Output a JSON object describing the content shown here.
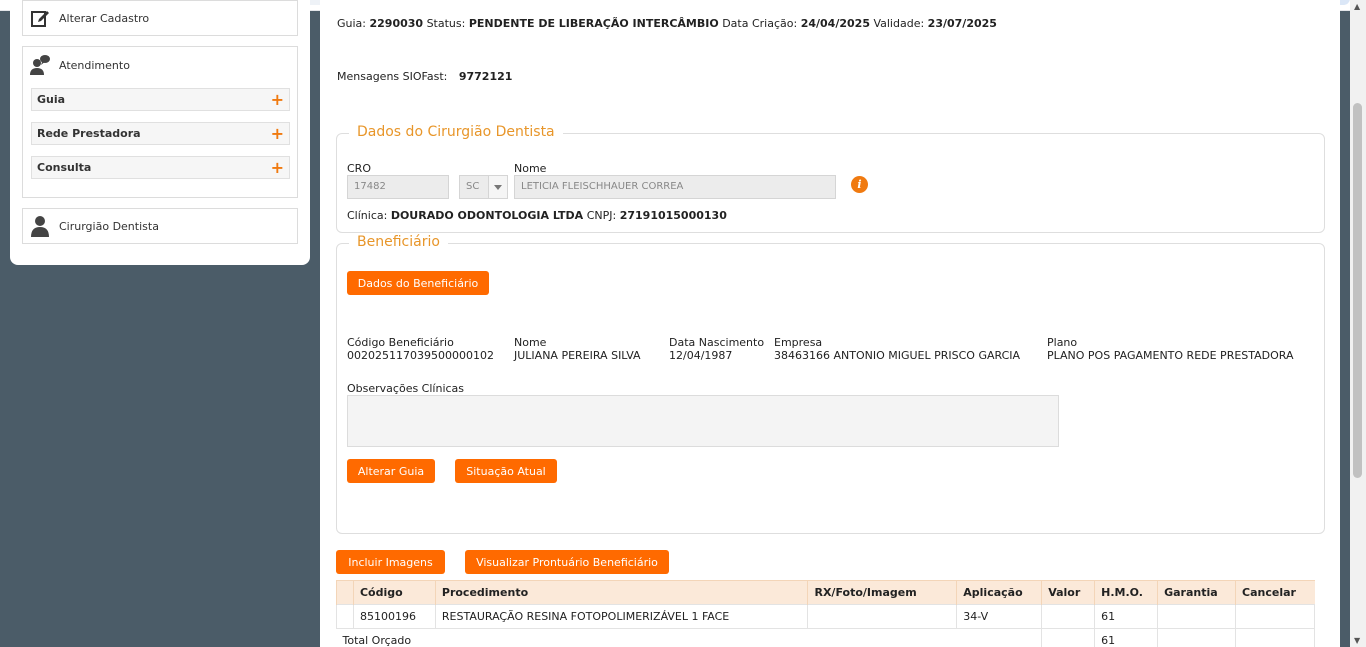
{
  "sidebar": {
    "alterar_cadastro": "Alterar Cadastro",
    "atendimento": "Atendimento",
    "subitems": [
      "Guia",
      "Rede Prestadora",
      "Consulta"
    ],
    "cirurgiao": "Cirurgião Dentista"
  },
  "header": {
    "guia_label": "Guia:",
    "guia_value": "2290030",
    "status_label": "Status:",
    "status_value": "PENDENTE DE LIBERAÇÃO INTERCÂMBIO",
    "criacao_label": "Data Criação:",
    "criacao_value": "24/04/2025",
    "validade_label": "Validade:",
    "validade_value": "23/07/2025",
    "mensagens_label": "Mensagens SIOFast:",
    "mensagens_value": "9772121"
  },
  "dentista": {
    "legend": "Dados do Cirurgião Dentista",
    "cro_label": "CRO",
    "cro_value": "17482",
    "uf_value": "SC",
    "nome_label": "Nome",
    "nome_value": "LETICIA FLEISCHHAUER CORREA",
    "clinica_label": "Clínica:",
    "clinica_value": "DOURADO ODONTOLOGIA LTDA",
    "cnpj_label": "CNPJ:",
    "cnpj_value": "27191015000130"
  },
  "beneficiario": {
    "legend": "Beneficiário",
    "dados_button": "Dados do Beneficiário",
    "codigo_label": "Código Beneficiário",
    "codigo_value": "00202511703950000010​2",
    "nome_label": "Nome",
    "nome_value": "JULIANA PEREIRA SILVA",
    "nascimento_label": "Data Nascimento",
    "nascimento_value": "12/04/1987",
    "empresa_label": "Empresa",
    "empresa_value": "38463166 ANTONIO MIGUEL PRISCO GARCIA",
    "plano_label": "Plano",
    "plano_value": "PLANO POS PAGAMENTO REDE PRESTADORA",
    "obs_label": "Observações Clínicas",
    "alterar_button": "Alterar Guia",
    "situacao_button": "Situação Atual"
  },
  "actions": {
    "incluir_button": "Incluir Imagens",
    "visualizar_button": "Visualizar Prontuário Beneficiário"
  },
  "table": {
    "headers": [
      "",
      "Código",
      "Procedimento",
      "RX/Foto/Imagem",
      "Aplicação",
      "Valor",
      "H.M.O.",
      "Garantia",
      "Cancelar"
    ],
    "row": {
      "codigo": "85100196",
      "procedimento": "RESTAURAÇÃO RESINA FOTOPOLIMERIZÁVEL 1 FACE",
      "rx": "",
      "aplicacao": "34-V",
      "valor": "",
      "hmo": "61",
      "garantia": "",
      "cancelar": ""
    },
    "total_label": "Total Orçado",
    "total_hmo": "61"
  },
  "colors": {
    "accent": "#ff6a00",
    "legend": "#e8962a",
    "sidebar_bg": "#4b5c68",
    "table_header_bg": "#fbe9d9"
  }
}
